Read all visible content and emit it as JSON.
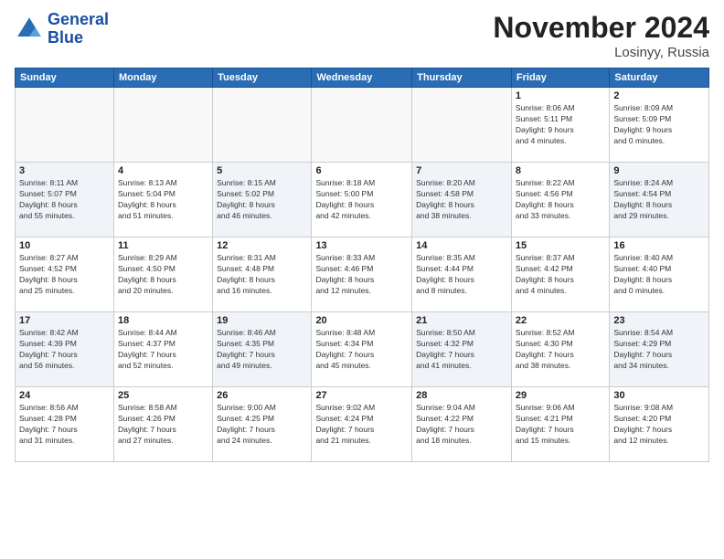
{
  "logo": {
    "line1": "General",
    "line2": "Blue"
  },
  "title": "November 2024",
  "location": "Losinyy, Russia",
  "days_header": [
    "Sunday",
    "Monday",
    "Tuesday",
    "Wednesday",
    "Thursday",
    "Friday",
    "Saturday"
  ],
  "weeks": [
    [
      {
        "day": "",
        "info": ""
      },
      {
        "day": "",
        "info": ""
      },
      {
        "day": "",
        "info": ""
      },
      {
        "day": "",
        "info": ""
      },
      {
        "day": "",
        "info": ""
      },
      {
        "day": "1",
        "info": "Sunrise: 8:06 AM\nSunset: 5:11 PM\nDaylight: 9 hours\nand 4 minutes."
      },
      {
        "day": "2",
        "info": "Sunrise: 8:09 AM\nSunset: 5:09 PM\nDaylight: 9 hours\nand 0 minutes."
      }
    ],
    [
      {
        "day": "3",
        "info": "Sunrise: 8:11 AM\nSunset: 5:07 PM\nDaylight: 8 hours\nand 55 minutes."
      },
      {
        "day": "4",
        "info": "Sunrise: 8:13 AM\nSunset: 5:04 PM\nDaylight: 8 hours\nand 51 minutes."
      },
      {
        "day": "5",
        "info": "Sunrise: 8:15 AM\nSunset: 5:02 PM\nDaylight: 8 hours\nand 46 minutes."
      },
      {
        "day": "6",
        "info": "Sunrise: 8:18 AM\nSunset: 5:00 PM\nDaylight: 8 hours\nand 42 minutes."
      },
      {
        "day": "7",
        "info": "Sunrise: 8:20 AM\nSunset: 4:58 PM\nDaylight: 8 hours\nand 38 minutes."
      },
      {
        "day": "8",
        "info": "Sunrise: 8:22 AM\nSunset: 4:56 PM\nDaylight: 8 hours\nand 33 minutes."
      },
      {
        "day": "9",
        "info": "Sunrise: 8:24 AM\nSunset: 4:54 PM\nDaylight: 8 hours\nand 29 minutes."
      }
    ],
    [
      {
        "day": "10",
        "info": "Sunrise: 8:27 AM\nSunset: 4:52 PM\nDaylight: 8 hours\nand 25 minutes."
      },
      {
        "day": "11",
        "info": "Sunrise: 8:29 AM\nSunset: 4:50 PM\nDaylight: 8 hours\nand 20 minutes."
      },
      {
        "day": "12",
        "info": "Sunrise: 8:31 AM\nSunset: 4:48 PM\nDaylight: 8 hours\nand 16 minutes."
      },
      {
        "day": "13",
        "info": "Sunrise: 8:33 AM\nSunset: 4:46 PM\nDaylight: 8 hours\nand 12 minutes."
      },
      {
        "day": "14",
        "info": "Sunrise: 8:35 AM\nSunset: 4:44 PM\nDaylight: 8 hours\nand 8 minutes."
      },
      {
        "day": "15",
        "info": "Sunrise: 8:37 AM\nSunset: 4:42 PM\nDaylight: 8 hours\nand 4 minutes."
      },
      {
        "day": "16",
        "info": "Sunrise: 8:40 AM\nSunset: 4:40 PM\nDaylight: 8 hours\nand 0 minutes."
      }
    ],
    [
      {
        "day": "17",
        "info": "Sunrise: 8:42 AM\nSunset: 4:39 PM\nDaylight: 7 hours\nand 56 minutes."
      },
      {
        "day": "18",
        "info": "Sunrise: 8:44 AM\nSunset: 4:37 PM\nDaylight: 7 hours\nand 52 minutes."
      },
      {
        "day": "19",
        "info": "Sunrise: 8:46 AM\nSunset: 4:35 PM\nDaylight: 7 hours\nand 49 minutes."
      },
      {
        "day": "20",
        "info": "Sunrise: 8:48 AM\nSunset: 4:34 PM\nDaylight: 7 hours\nand 45 minutes."
      },
      {
        "day": "21",
        "info": "Sunrise: 8:50 AM\nSunset: 4:32 PM\nDaylight: 7 hours\nand 41 minutes."
      },
      {
        "day": "22",
        "info": "Sunrise: 8:52 AM\nSunset: 4:30 PM\nDaylight: 7 hours\nand 38 minutes."
      },
      {
        "day": "23",
        "info": "Sunrise: 8:54 AM\nSunset: 4:29 PM\nDaylight: 7 hours\nand 34 minutes."
      }
    ],
    [
      {
        "day": "24",
        "info": "Sunrise: 8:56 AM\nSunset: 4:28 PM\nDaylight: 7 hours\nand 31 minutes."
      },
      {
        "day": "25",
        "info": "Sunrise: 8:58 AM\nSunset: 4:26 PM\nDaylight: 7 hours\nand 27 minutes."
      },
      {
        "day": "26",
        "info": "Sunrise: 9:00 AM\nSunset: 4:25 PM\nDaylight: 7 hours\nand 24 minutes."
      },
      {
        "day": "27",
        "info": "Sunrise: 9:02 AM\nSunset: 4:24 PM\nDaylight: 7 hours\nand 21 minutes."
      },
      {
        "day": "28",
        "info": "Sunrise: 9:04 AM\nSunset: 4:22 PM\nDaylight: 7 hours\nand 18 minutes."
      },
      {
        "day": "29",
        "info": "Sunrise: 9:06 AM\nSunset: 4:21 PM\nDaylight: 7 hours\nand 15 minutes."
      },
      {
        "day": "30",
        "info": "Sunrise: 9:08 AM\nSunset: 4:20 PM\nDaylight: 7 hours\nand 12 minutes."
      }
    ]
  ]
}
